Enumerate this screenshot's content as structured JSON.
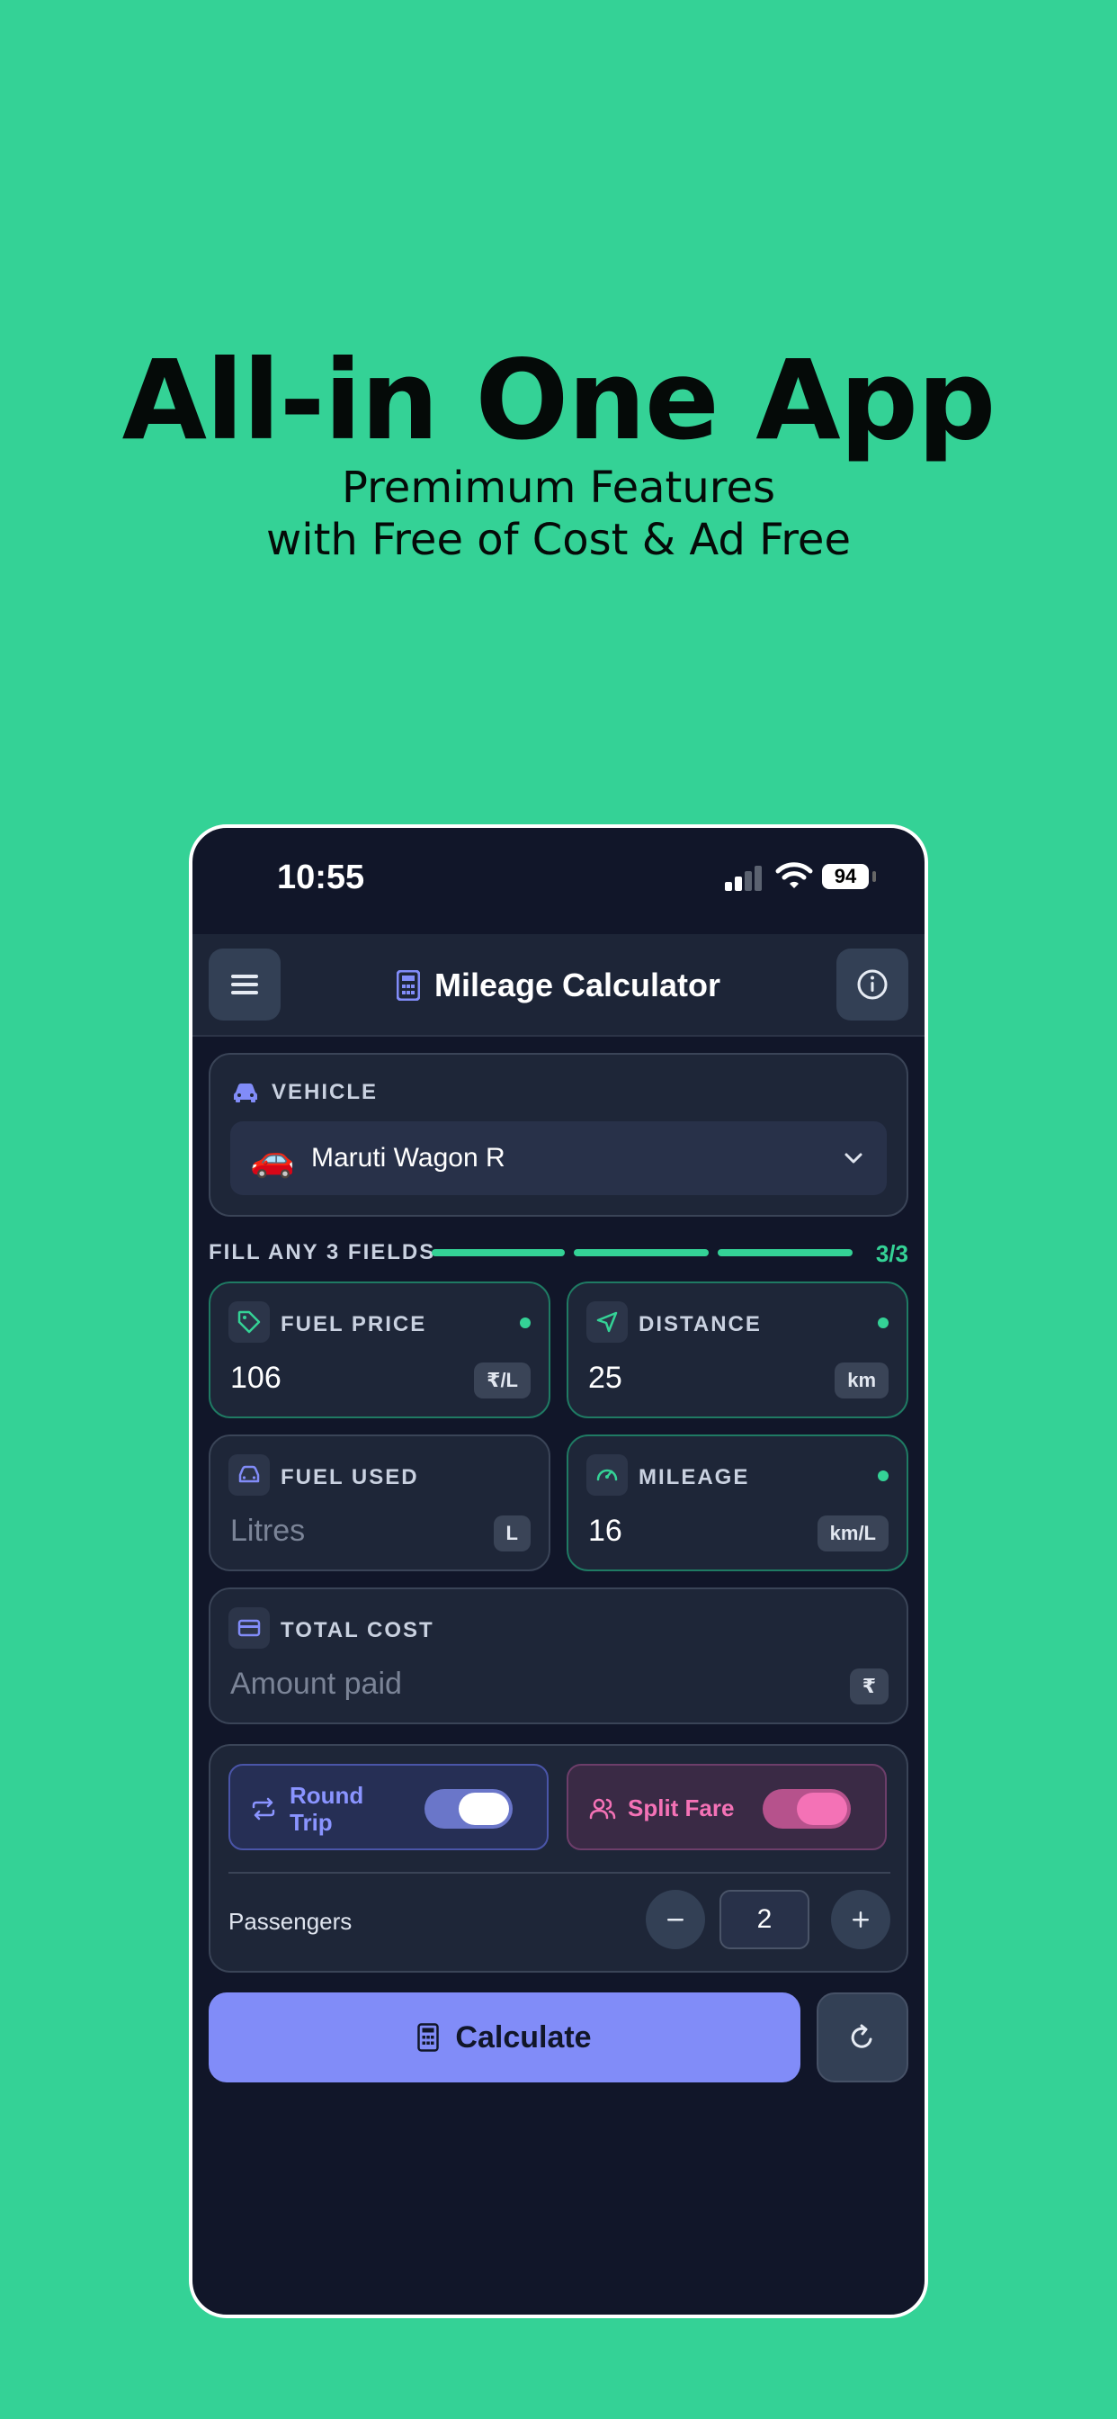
{
  "promo": {
    "title": "All-in One App",
    "subtitle_line1": "Premimum Features",
    "subtitle_line2": "with Free of Cost & Ad Free"
  },
  "status_bar": {
    "time": "10:55",
    "battery": "94"
  },
  "header": {
    "title": "Mileage Calculator"
  },
  "vehicle": {
    "label": "VEHICLE",
    "emoji": "🚗",
    "selected": "Maruti Wagon R"
  },
  "fill_status": {
    "label": "FILL ANY 3 FIELDS",
    "count": "3/3",
    "filled": 3,
    "total": 3
  },
  "fields": {
    "fuel_price": {
      "label": "FUEL PRICE",
      "value": "106",
      "unit": "₹/L"
    },
    "distance": {
      "label": "DISTANCE",
      "value": "25",
      "unit": "km"
    },
    "fuel_used": {
      "label": "FUEL USED",
      "placeholder": "Litres",
      "unit": "L"
    },
    "mileage": {
      "label": "MILEAGE",
      "value": "16",
      "unit": "km/L"
    },
    "total_cost": {
      "label": "TOTAL COST",
      "placeholder": "Amount paid",
      "unit": "₹"
    }
  },
  "options": {
    "round_trip": {
      "label": "Round Trip",
      "enabled": true
    },
    "split_fare": {
      "label": "Split Fare",
      "enabled": true
    },
    "passengers": {
      "label": "Passengers",
      "value": "2"
    }
  },
  "actions": {
    "calculate_label": "Calculate"
  },
  "colors": {
    "page_background": "#34d296",
    "app_background": "#111629",
    "accent": "#818cf8",
    "success": "#34d296",
    "split_pink": "#f472b6"
  }
}
